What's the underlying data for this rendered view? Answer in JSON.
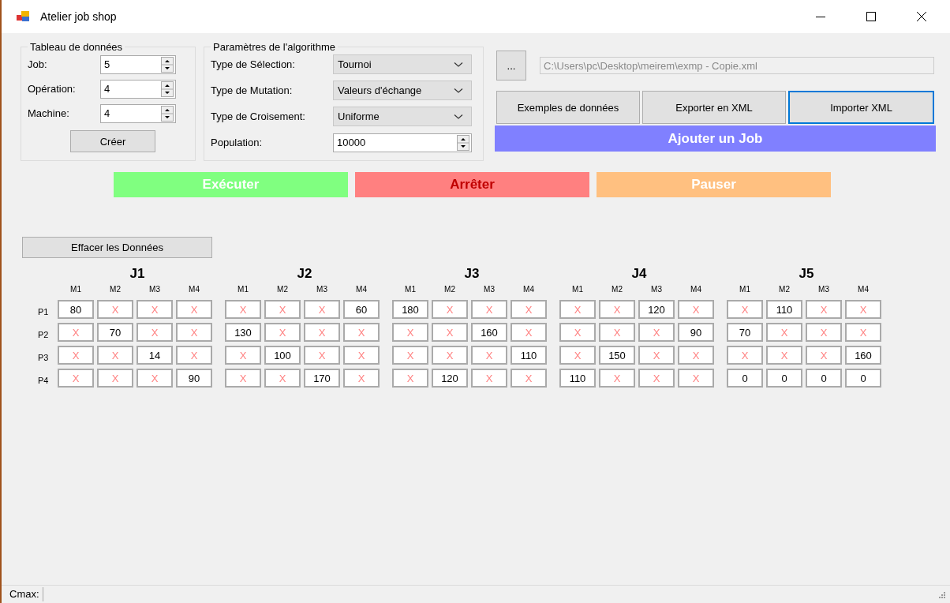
{
  "window": {
    "title": "Atelier job shop"
  },
  "data_group": {
    "title": "Tableau de données",
    "fields": [
      {
        "label": "Job:",
        "value": "5"
      },
      {
        "label": "Opération:",
        "value": "4"
      },
      {
        "label": "Machine:",
        "value": "4"
      }
    ],
    "create_button": "Créer"
  },
  "algorithm_group": {
    "title": "Paramètres de l'algorithme",
    "fields": [
      {
        "kind": "dropdown",
        "label": "Type de Sélection:",
        "value": "Tournoi"
      },
      {
        "kind": "dropdown",
        "label": "Type de Mutation:",
        "value": "Valeurs d'échange"
      },
      {
        "kind": "dropdown",
        "label": "Type de Croisement:",
        "value": "Uniforme"
      },
      {
        "kind": "spinner",
        "label": "Population:",
        "value": "10000"
      }
    ]
  },
  "file": {
    "browse_button": "...",
    "path": "C:\\Users\\pc\\Desktop\\meirem\\exmp - Copie.xml",
    "disabled": true
  },
  "file_buttons": [
    {
      "label": "Exemples de données",
      "focused": false
    },
    {
      "label": "Exporter en  XML",
      "focused": false
    },
    {
      "label": "Importer XML",
      "focused": true
    }
  ],
  "add_job_button": "Ajouter  un Job",
  "run_buttons": [
    {
      "label": "Exécuter",
      "kind": "run"
    },
    {
      "label": "Arrêter",
      "kind": "stop"
    },
    {
      "label": "Pauser",
      "kind": "pause"
    }
  ],
  "clear_button": "Effacer les Données",
  "row_labels": [
    "P1",
    "P2",
    "P3",
    "P4"
  ],
  "jobs": [
    {
      "title": "J1",
      "machines": [
        "M1",
        "M2",
        "M3",
        "M4"
      ],
      "rows": [
        [
          {
            "text": "80",
            "kind": "value"
          },
          {
            "text": "X",
            "kind": "empty"
          },
          {
            "text": "X",
            "kind": "empty"
          },
          {
            "text": "X",
            "kind": "empty"
          }
        ],
        [
          {
            "text": "X",
            "kind": "empty"
          },
          {
            "text": "70",
            "kind": "value"
          },
          {
            "text": "X",
            "kind": "empty"
          },
          {
            "text": "X",
            "kind": "empty"
          }
        ],
        [
          {
            "text": "X",
            "kind": "empty"
          },
          {
            "text": "X",
            "kind": "empty"
          },
          {
            "text": "14",
            "kind": "value"
          },
          {
            "text": "X",
            "kind": "empty"
          }
        ],
        [
          {
            "text": "X",
            "kind": "empty"
          },
          {
            "text": "X",
            "kind": "empty"
          },
          {
            "text": "X",
            "kind": "empty"
          },
          {
            "text": "90",
            "kind": "value"
          }
        ]
      ]
    },
    {
      "title": "J2",
      "machines": [
        "M1",
        "M2",
        "M3",
        "M4"
      ],
      "rows": [
        [
          {
            "text": "X",
            "kind": "empty"
          },
          {
            "text": "X",
            "kind": "empty"
          },
          {
            "text": "X",
            "kind": "empty"
          },
          {
            "text": "60",
            "kind": "value"
          }
        ],
        [
          {
            "text": "130",
            "kind": "value"
          },
          {
            "text": "X",
            "kind": "empty"
          },
          {
            "text": "X",
            "kind": "empty"
          },
          {
            "text": "X",
            "kind": "empty"
          }
        ],
        [
          {
            "text": "X",
            "kind": "empty"
          },
          {
            "text": "100",
            "kind": "value"
          },
          {
            "text": "X",
            "kind": "empty"
          },
          {
            "text": "X",
            "kind": "empty"
          }
        ],
        [
          {
            "text": "X",
            "kind": "empty"
          },
          {
            "text": "X",
            "kind": "empty"
          },
          {
            "text": "170",
            "kind": "value"
          },
          {
            "text": "X",
            "kind": "empty"
          }
        ]
      ]
    },
    {
      "title": "J3",
      "machines": [
        "M1",
        "M2",
        "M3",
        "M4"
      ],
      "rows": [
        [
          {
            "text": "180",
            "kind": "value"
          },
          {
            "text": "X",
            "kind": "empty"
          },
          {
            "text": "X",
            "kind": "empty"
          },
          {
            "text": "X",
            "kind": "empty"
          }
        ],
        [
          {
            "text": "X",
            "kind": "empty"
          },
          {
            "text": "X",
            "kind": "empty"
          },
          {
            "text": "160",
            "kind": "value"
          },
          {
            "text": "X",
            "kind": "empty"
          }
        ],
        [
          {
            "text": "X",
            "kind": "empty"
          },
          {
            "text": "X",
            "kind": "empty"
          },
          {
            "text": "X",
            "kind": "empty"
          },
          {
            "text": "110",
            "kind": "value"
          }
        ],
        [
          {
            "text": "X",
            "kind": "empty"
          },
          {
            "text": "120",
            "kind": "value"
          },
          {
            "text": "X",
            "kind": "empty"
          },
          {
            "text": "X",
            "kind": "empty"
          }
        ]
      ]
    },
    {
      "title": "J4",
      "machines": [
        "M1",
        "M2",
        "M3",
        "M4"
      ],
      "rows": [
        [
          {
            "text": "X",
            "kind": "empty"
          },
          {
            "text": "X",
            "kind": "empty"
          },
          {
            "text": "120",
            "kind": "value"
          },
          {
            "text": "X",
            "kind": "empty"
          }
        ],
        [
          {
            "text": "X",
            "kind": "empty"
          },
          {
            "text": "X",
            "kind": "empty"
          },
          {
            "text": "X",
            "kind": "empty"
          },
          {
            "text": "90",
            "kind": "value"
          }
        ],
        [
          {
            "text": "X",
            "kind": "empty"
          },
          {
            "text": "150",
            "kind": "value"
          },
          {
            "text": "X",
            "kind": "empty"
          },
          {
            "text": "X",
            "kind": "empty"
          }
        ],
        [
          {
            "text": "110",
            "kind": "value"
          },
          {
            "text": "X",
            "kind": "empty"
          },
          {
            "text": "X",
            "kind": "empty"
          },
          {
            "text": "X",
            "kind": "empty"
          }
        ]
      ]
    },
    {
      "title": "J5",
      "machines": [
        "M1",
        "M2",
        "M3",
        "M4"
      ],
      "rows": [
        [
          {
            "text": "X",
            "kind": "empty"
          },
          {
            "text": "110",
            "kind": "value"
          },
          {
            "text": "X",
            "kind": "empty"
          },
          {
            "text": "X",
            "kind": "empty"
          }
        ],
        [
          {
            "text": "70",
            "kind": "value"
          },
          {
            "text": "X",
            "kind": "empty"
          },
          {
            "text": "X",
            "kind": "empty"
          },
          {
            "text": "X",
            "kind": "empty"
          }
        ],
        [
          {
            "text": "X",
            "kind": "empty"
          },
          {
            "text": "X",
            "kind": "empty"
          },
          {
            "text": "X",
            "kind": "empty"
          },
          {
            "text": "160",
            "kind": "value"
          }
        ],
        [
          {
            "text": "0",
            "kind": "value"
          },
          {
            "text": "0",
            "kind": "value"
          },
          {
            "text": "0",
            "kind": "value"
          },
          {
            "text": "0",
            "kind": "value"
          }
        ]
      ]
    }
  ],
  "status_bar": {
    "label": "Cmax:"
  }
}
